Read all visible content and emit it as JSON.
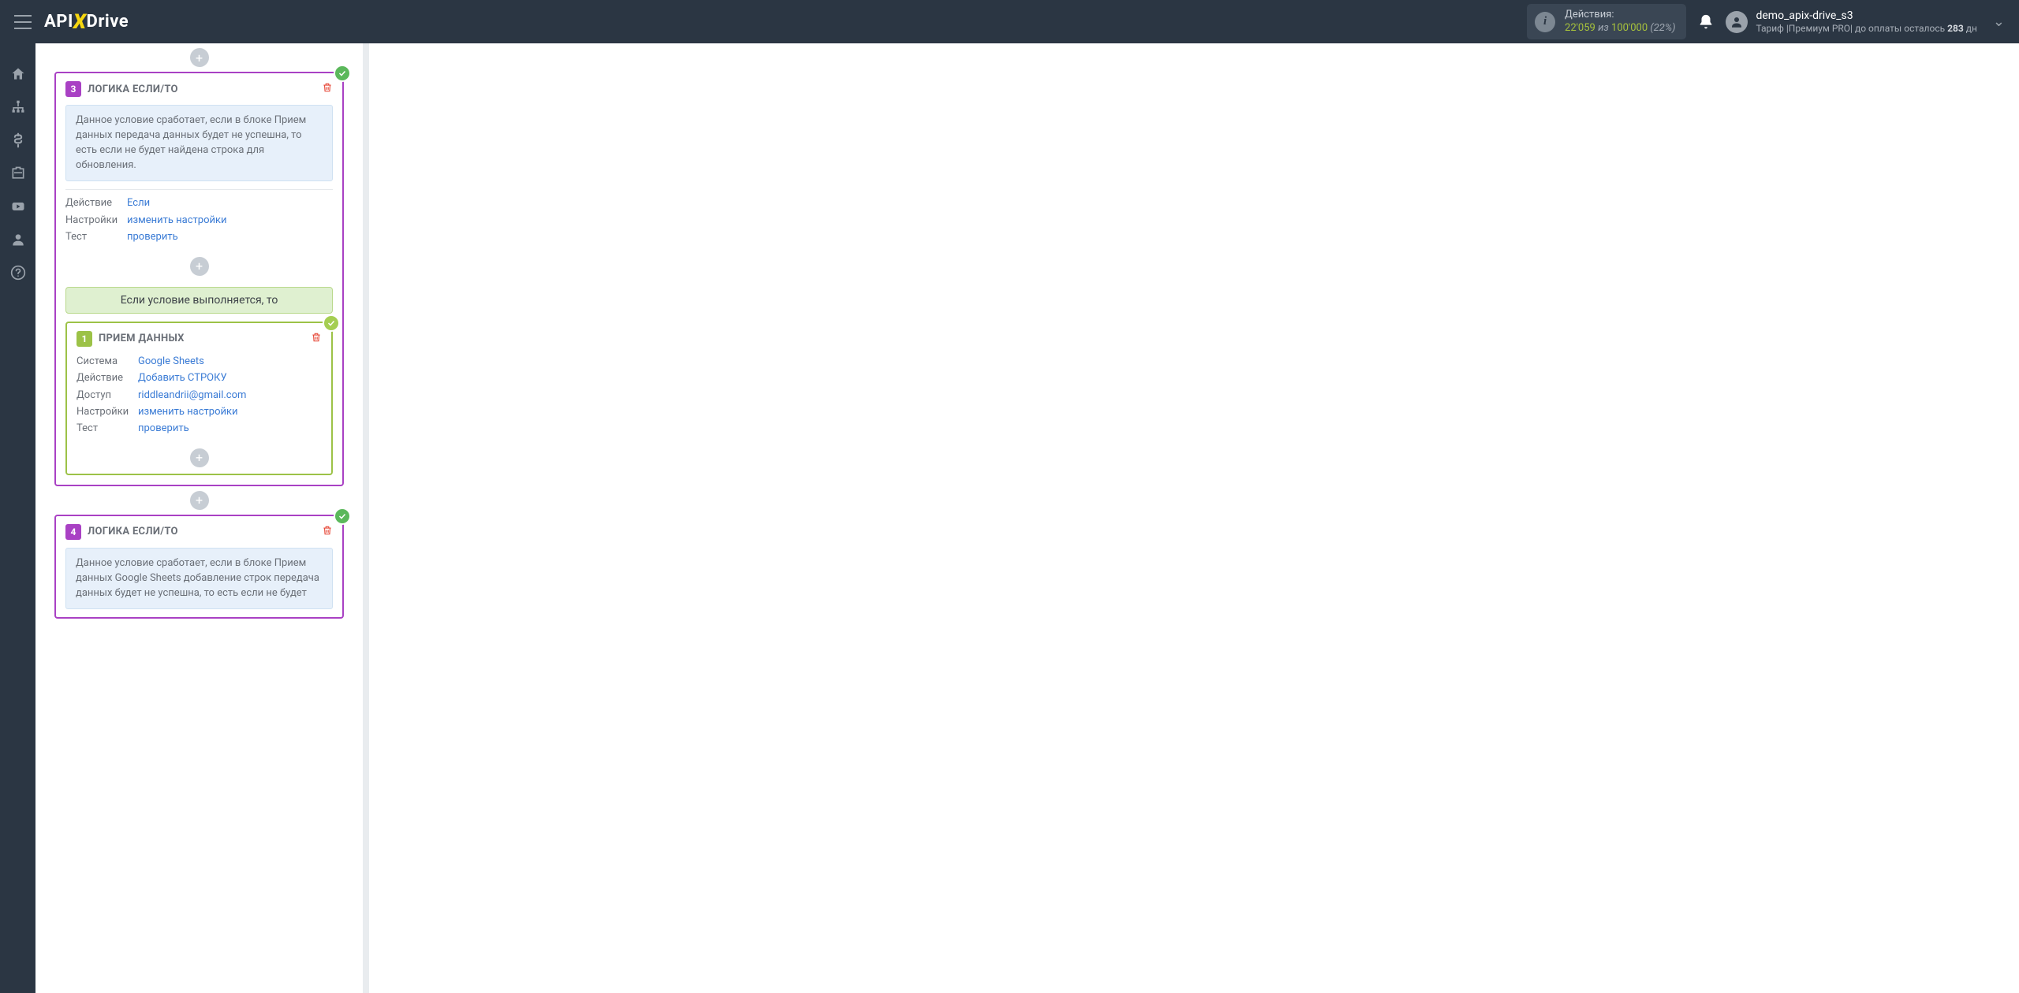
{
  "topbar": {
    "logo_api": "API",
    "logo_drive": "Drive",
    "actions_label": "Действия:",
    "actions_used": "22'059",
    "actions_iz": "из",
    "actions_total": "100'000",
    "actions_pct": "(22%)",
    "user_name": "demo_apix-drive_s3",
    "user_sub_prefix": "Тариф |Премиум PRO| до оплаты осталось ",
    "user_sub_days": "283",
    "user_sub_suffix": " дн"
  },
  "card3": {
    "num": "3",
    "title": "ЛОГИКА ЕСЛИ/ТО",
    "info": "Данное условие сработает, если в блоке Прием данных передача данных будет не успешна, то есть если не будет найдена строка для обновления.",
    "rows": {
      "action_k": "Действие",
      "action_v": "Если",
      "settings_k": "Настройки",
      "settings_v": "изменить настройки",
      "test_k": "Тест",
      "test_v": "проверить"
    },
    "cond_text": "Если условие выполняется, то"
  },
  "inner1": {
    "num": "1",
    "title": "ПРИЕМ ДАННЫХ",
    "rows": {
      "system_k": "Система",
      "system_v": "Google Sheets",
      "action_k": "Действие",
      "action_v": "Добавить СТРОКУ",
      "access_k": "Доступ",
      "access_v": "riddleandrii@gmail.com",
      "settings_k": "Настройки",
      "settings_v": "изменить настройки",
      "test_k": "Тест",
      "test_v": "проверить"
    }
  },
  "card4": {
    "num": "4",
    "title": "ЛОГИКА ЕСЛИ/ТО",
    "info": "Данное условие сработает, если в блоке Прием данных Google Sheets добавление строк передача данных будет не успешна, то есть если не будет"
  }
}
